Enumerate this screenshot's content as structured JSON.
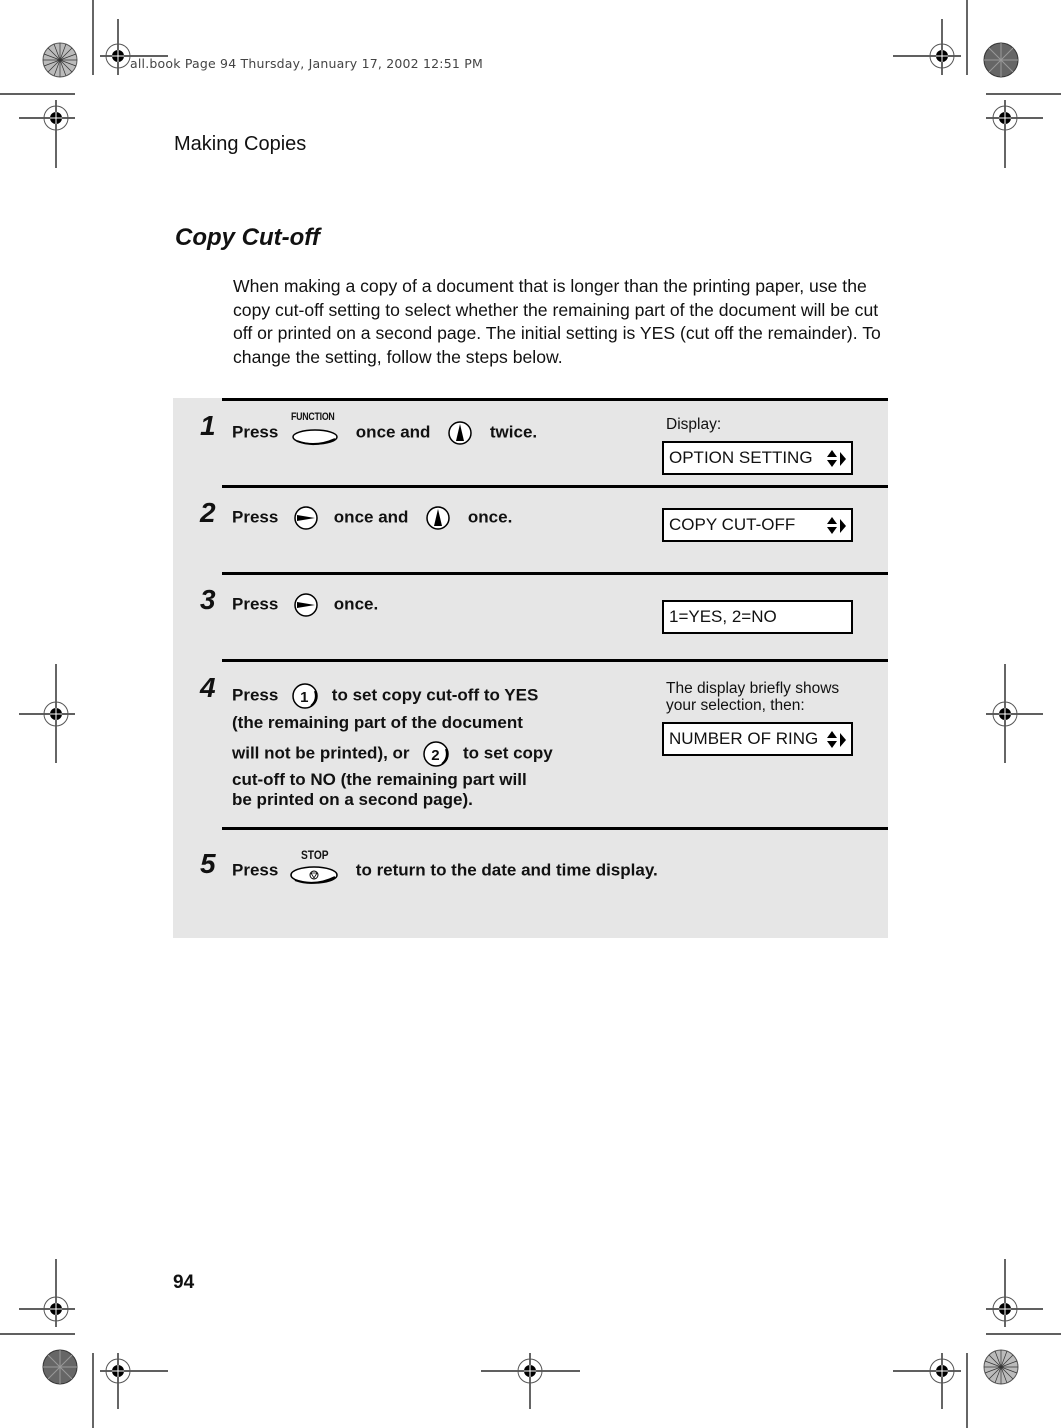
{
  "slug": "all.book  Page 94  Thursday, January 17, 2002  12:51 PM",
  "header": {
    "section": "Making Copies"
  },
  "title": "Copy Cut-off",
  "intro": "When making a copy of a document that is longer than the printing paper, use the copy cut-off setting to select whether the remaining part of the document will be cut off or printed on a second page. The initial setting is YES (cut off the remainder). To change the setting, follow the steps below.",
  "display_label": "Display:",
  "keys": {
    "function": "FUNCTION",
    "stop": "STOP",
    "one": "1",
    "two": "2"
  },
  "steps": [
    {
      "num": "1",
      "press": "Press",
      "mid": "once and",
      "end": "twice."
    },
    {
      "num": "2",
      "press": "Press",
      "mid": "once and",
      "end": "once."
    },
    {
      "num": "3",
      "press": "Press",
      "end": "once."
    },
    {
      "num": "4",
      "press": "Press",
      "line1": "to set copy cut-off to YES",
      "line2": "(the remaining part of the document",
      "line3a": "will not be printed), or",
      "line3b": "to set copy",
      "line4": "cut-off to NO (the remaining part will",
      "line5": "be printed on a second page)."
    },
    {
      "num": "5",
      "press": "Press",
      "end": "to return to the date and time display."
    }
  ],
  "displays": [
    {
      "text": "OPTION SETTING",
      "arrows": "up-down-right"
    },
    {
      "text": "COPY CUT-OFF",
      "arrows": "up-down-right"
    },
    {
      "text": "1=YES, 2=NO",
      "arrows": "none"
    },
    {
      "text": "NUMBER OF RING",
      "arrows": "up-down-right"
    }
  ],
  "note_step4": {
    "line1": "The display briefly shows",
    "line2": "your selection, then:"
  },
  "page_number": "94"
}
